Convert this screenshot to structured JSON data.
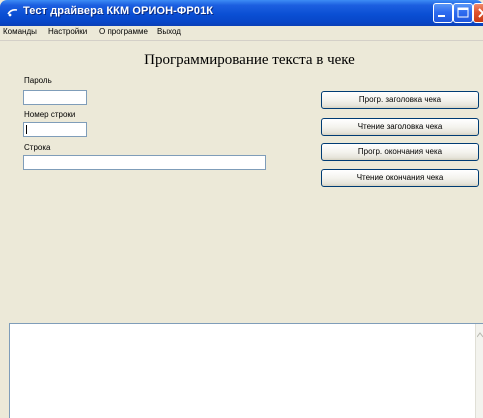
{
  "window": {
    "title": "Тест драйвера ККМ ОРИОН-ФР01К"
  },
  "menu": {
    "items": [
      "Команды",
      "Настройки",
      "О программе",
      "Выход"
    ]
  },
  "main": {
    "heading": "Программирование текста в чеке",
    "password_label": "Пароль",
    "password_value": "",
    "line_number_label": "Номер строки",
    "line_number_value": "",
    "string_label": "Строка",
    "string_value": ""
  },
  "buttons": {
    "prog_header": "Прогр. заголовка чека",
    "read_header": "Чтение заголовка чека",
    "prog_footer": "Прогр. окончания чека",
    "read_footer": "Чтение окончания чека"
  },
  "log": {
    "text": ""
  },
  "colors": {
    "titlebar": "#0a4fd4",
    "window_bg": "#ece9d8",
    "field_border": "#7f9db9",
    "button_border": "#003c74",
    "close_button": "#e0532e"
  },
  "icons": {
    "app": "app-icon",
    "minimize": "minimize-icon",
    "maximize": "maximize-icon",
    "close": "close-icon"
  }
}
